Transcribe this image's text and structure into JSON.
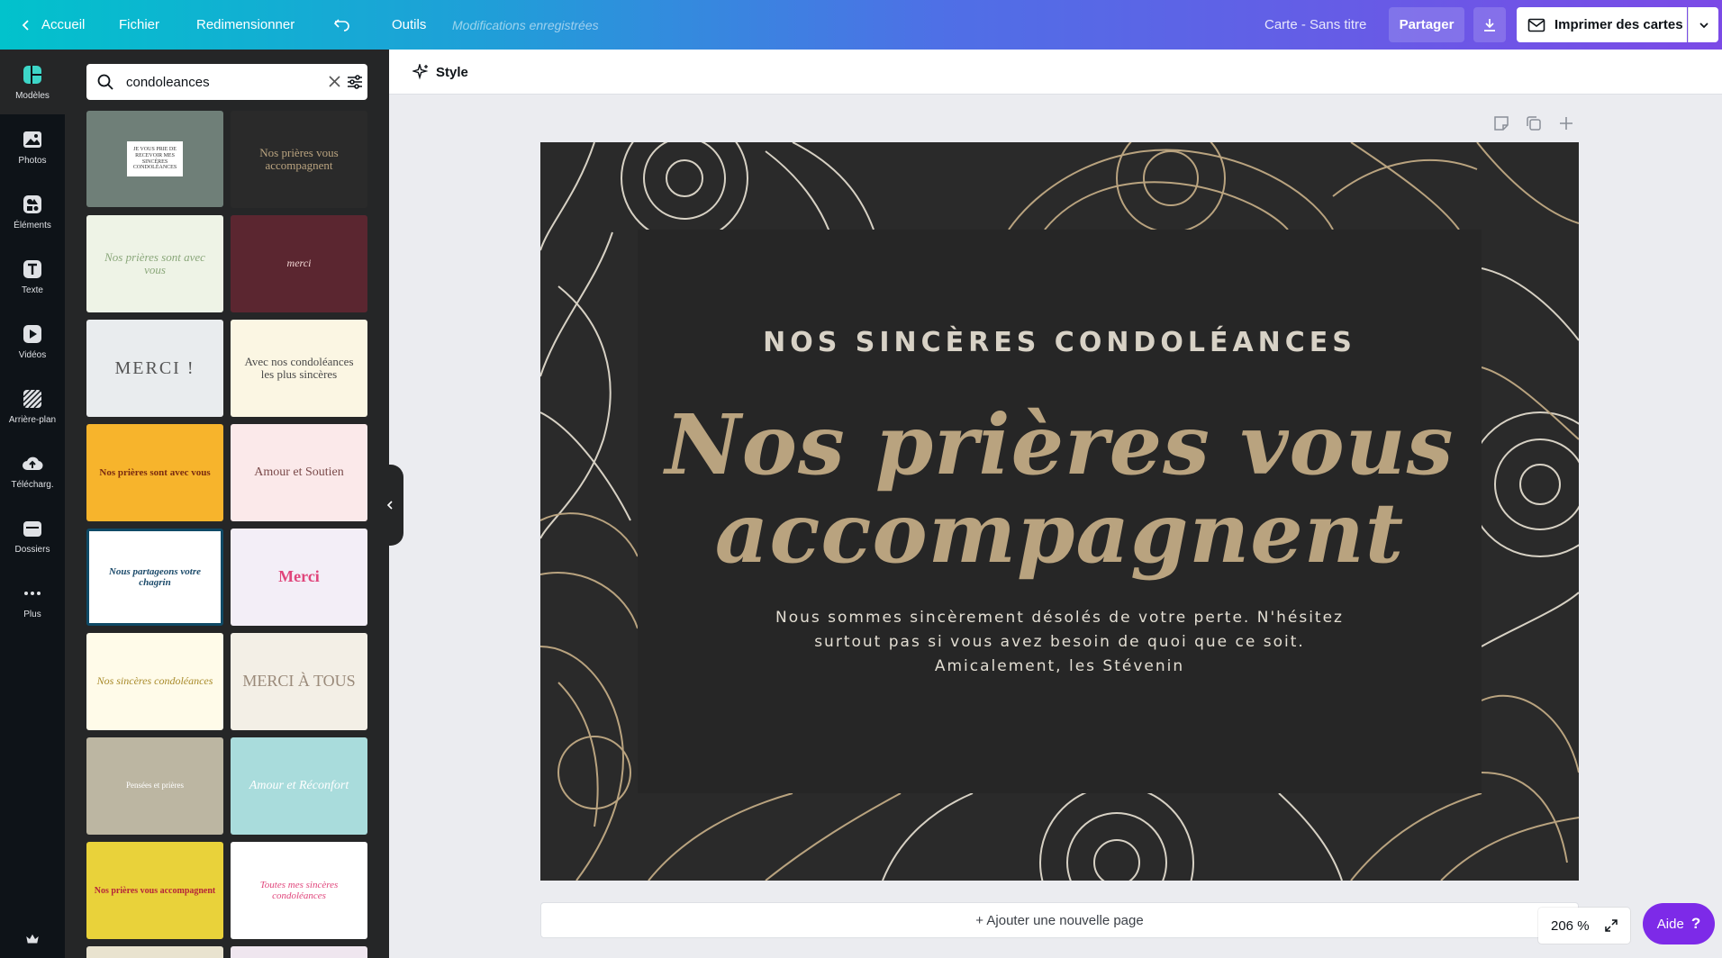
{
  "topbar": {
    "home": "Accueil",
    "file": "Fichier",
    "resize": "Redimensionner",
    "tools": "Outils",
    "saved_status": "Modifications enregistrées",
    "doc_title": "Carte - Sans titre",
    "share": "Partager",
    "print": "Imprimer des cartes"
  },
  "rail": {
    "items": [
      {
        "label": "Modèles",
        "icon": "templates-icon"
      },
      {
        "label": "Photos",
        "icon": "photos-icon"
      },
      {
        "label": "Éléments",
        "icon": "elements-icon"
      },
      {
        "label": "Texte",
        "icon": "text-icon"
      },
      {
        "label": "Vidéos",
        "icon": "videos-icon"
      },
      {
        "label": "Arrière-plan",
        "icon": "background-icon"
      },
      {
        "label": "Téléchargements",
        "short": "Télécharg.",
        "icon": "upload-icon"
      },
      {
        "label": "Dossiers",
        "icon": "folders-icon"
      },
      {
        "label": "Plus",
        "icon": "more-icon"
      }
    ]
  },
  "search": {
    "value": "condoleances"
  },
  "templates": [
    {
      "title": "JE VOUS PRIE DE RECEVOIR MES SINCÈRES CONDOLÉANCES",
      "bg": "#6f7f78",
      "fg": "#333"
    },
    {
      "title": "Nos prières vous accompagnent",
      "bg": "#2a2a2a",
      "fg": "#b9a37f"
    },
    {
      "title": "Nos prières sont avec vous",
      "bg": "#eef3e6",
      "fg": "#8aa77a"
    },
    {
      "title": "merci",
      "bg": "#5b2630",
      "fg": "#f2d7d5"
    },
    {
      "title": "MERCI !",
      "bg": "#e9ecee",
      "fg": "#555"
    },
    {
      "title": "Avec nos condoléances les plus sincères",
      "bg": "#fbf6e3",
      "fg": "#4a4a4a"
    },
    {
      "title": "Nos prières sont avec vous",
      "bg": "#f7b42c",
      "fg": "#7a2b10"
    },
    {
      "title": "Amour et Soutien",
      "bg": "#fbe9ea",
      "fg": "#7a4a4a"
    },
    {
      "title": "Nous partageons votre chagrin",
      "bg": "#ffffff",
      "fg": "#1b4a6a"
    },
    {
      "title": "Merci",
      "bg": "#f3eef7",
      "fg": "#e0457b"
    },
    {
      "title": "Nos sincères condoléances",
      "bg": "#fffbe9",
      "fg": "#a88a2a"
    },
    {
      "title": "MERCI À TOUS",
      "bg": "#f3efe6",
      "fg": "#9a8a7a"
    },
    {
      "title": "Pensées et prières",
      "bg": "#bcb6a2",
      "fg": "#ffffff"
    },
    {
      "title": "Amour et Réconfort",
      "bg": "#a9dcdc",
      "fg": "#ffffff"
    },
    {
      "title": "Nos prières vous accompagnent",
      "bg": "#e9d23a",
      "fg": "#b5263a"
    },
    {
      "title": "Toutes mes sincères condoléances",
      "bg": "#ffffff",
      "fg": "#e0457b"
    }
  ],
  "toolbar": {
    "style": "Style"
  },
  "card": {
    "subtitle": "NOS SINCÈRES CONDOLÉANCES",
    "title_line1": "Nos prières vous",
    "title_line2": "accompagnent",
    "body_line1": "Nous sommes sincèrement désolés de votre perte. N'hésitez",
    "body_line2": "surtout pas si vous avez besoin de quoi que ce soit.",
    "body_line3": "Amicalement, les Stévenin"
  },
  "footer": {
    "add_page": "+ Ajouter une nouvelle page",
    "zoom": "206 %",
    "help": "Aide",
    "help_mark": "?"
  },
  "colors": {
    "accent": "#7d2ae8",
    "card_gold": "#b9a37f",
    "card_bg": "#262626"
  }
}
